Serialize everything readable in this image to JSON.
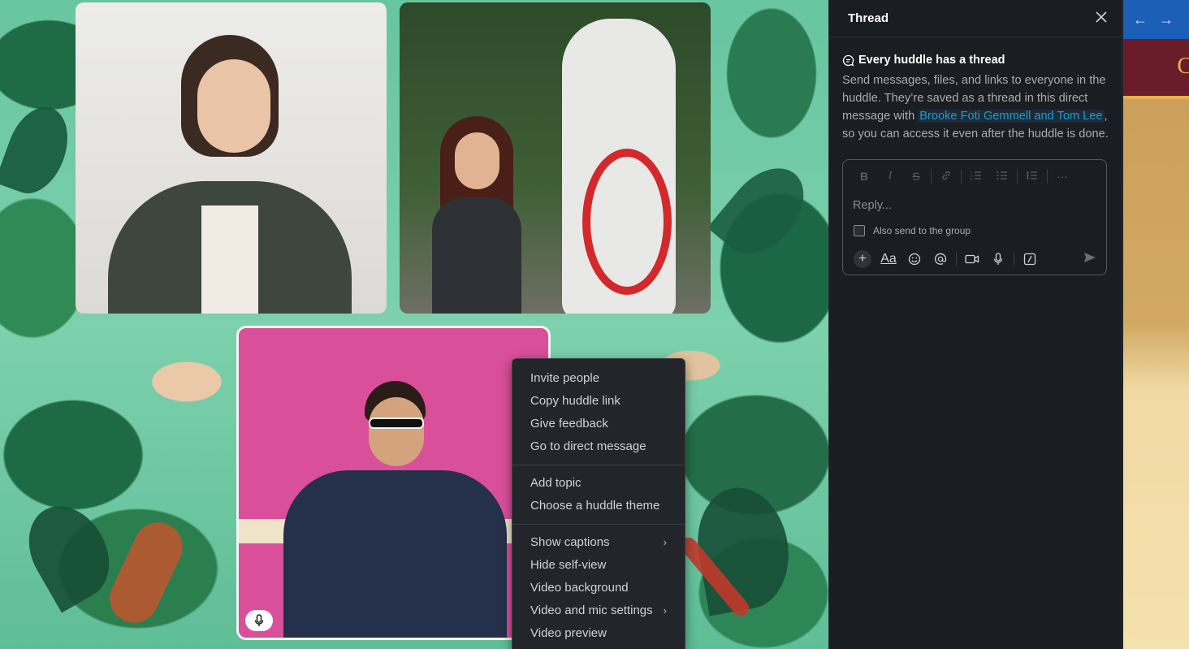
{
  "menu": {
    "items": [
      {
        "label": "Invite people"
      },
      {
        "label": "Copy huddle link"
      },
      {
        "label": "Give feedback"
      },
      {
        "label": "Go to direct message"
      },
      {
        "label": "Add topic"
      },
      {
        "label": "Choose a huddle theme"
      },
      {
        "label": "Show captions",
        "submenu": true
      },
      {
        "label": "Hide self-view"
      },
      {
        "label": "Video background"
      },
      {
        "label": "Video and mic settings",
        "submenu": true
      },
      {
        "label": "Video preview"
      }
    ]
  },
  "thread": {
    "title": "Thread",
    "info_title": "Every huddle has a thread",
    "info_body_1": "Send messages, files, and links to everyone in the huddle. They’re saved as a thread in this direct message with ",
    "mention": "Brooke Foti Gemmell and Tom Lee",
    "info_body_2": ", so you can access it even after the huddle is done.",
    "reply_placeholder": "Reply...",
    "also_send_label": "Also send to the group",
    "also_send_checked": false
  },
  "icons": {
    "close": "close-icon",
    "thread": "thread-icon",
    "mic": "microphone-icon"
  },
  "strip": {
    "band_letter": "C"
  },
  "colors": {
    "mention": "#1d9bd1",
    "menu_bg": "#222529",
    "panel_bg": "#1a1d21",
    "speaker_border": "#f4f4f4"
  }
}
